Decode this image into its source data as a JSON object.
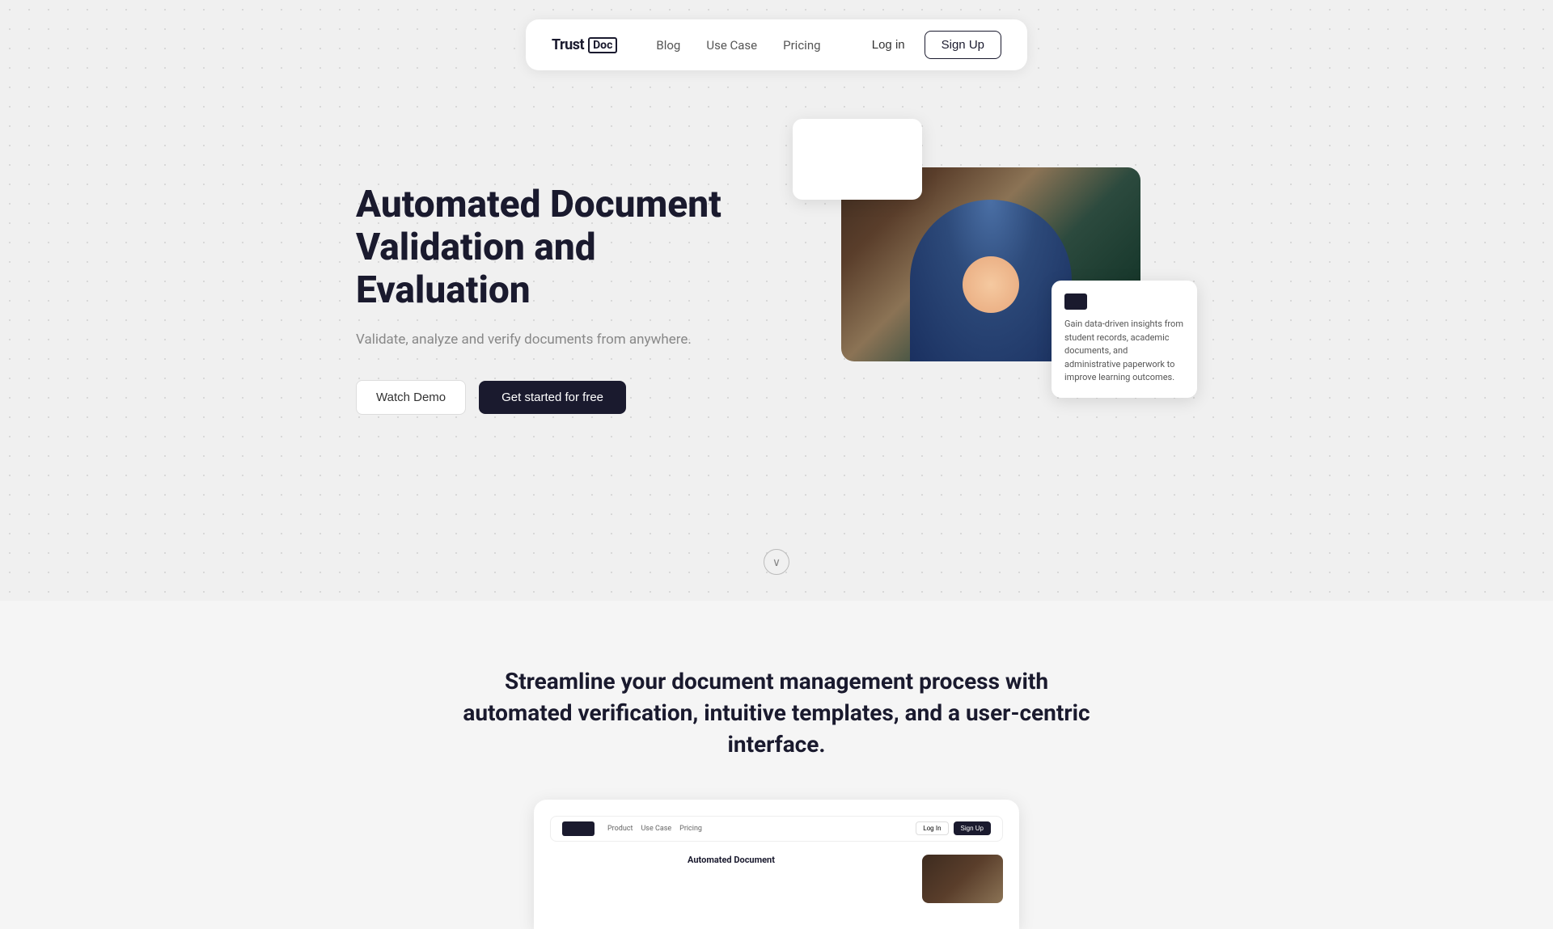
{
  "brand": {
    "name": "Trust",
    "name2": "Doc",
    "logo_label": "TrustDoc"
  },
  "navbar": {
    "links": [
      {
        "label": "Blog",
        "id": "blog"
      },
      {
        "label": "Use Case",
        "id": "use-case"
      },
      {
        "label": "Pricing",
        "id": "pricing"
      }
    ],
    "login_label": "Log in",
    "signup_label": "Sign Up"
  },
  "hero": {
    "title": "Automated Document Validation and Evaluation",
    "subtitle": "Validate, analyze and verify documents from anywhere.",
    "watch_demo_label": "Watch Demo",
    "get_started_label": "Get started for free"
  },
  "floating_card": {
    "description": "Gain data-driven insights from student records, academic documents, and administrative paperwork to improve learning outcomes."
  },
  "scroll_indicator": {
    "aria_label": "Scroll down"
  },
  "section2": {
    "title": "Streamline your document management process with automated verification, intuitive templates, and a user-centric interface.",
    "mini_nav": {
      "links": [
        "Product",
        "Use Case",
        "Pricing"
      ],
      "login_label": "Log In",
      "signup_label": "Sign Up"
    },
    "mini_hero_title": "Automated Document"
  }
}
